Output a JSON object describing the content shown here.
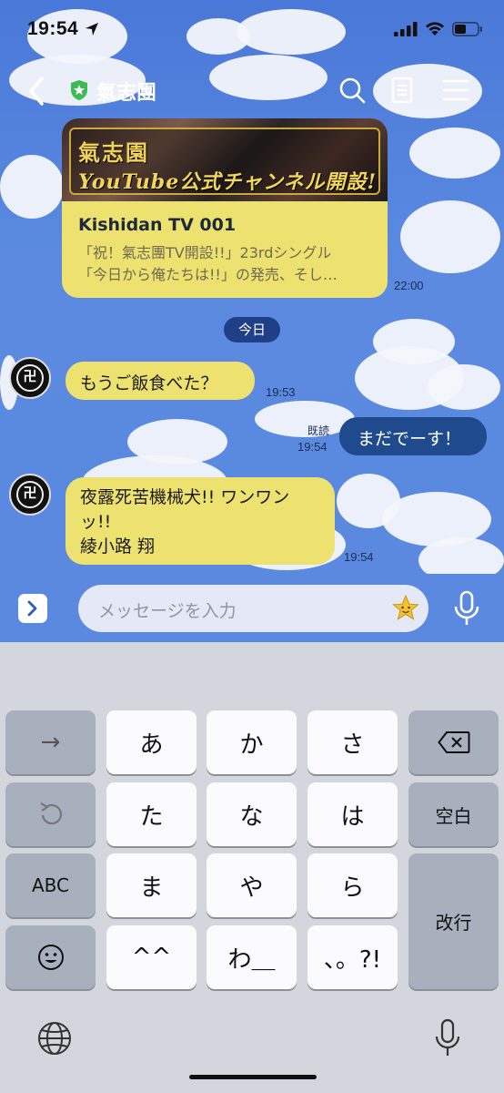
{
  "status_bar": {
    "time": "19:54"
  },
  "header": {
    "title": "氣志團"
  },
  "messages": {
    "card": {
      "image_line1": "氣志園",
      "image_line2": "YouTube公式チャンネル開設!",
      "title": "Kishidan TV 001",
      "desc_line1": "「祝！氣志團TV開設!!」23rdシングル",
      "desc_line2": "「今日から俺たちは!!」の発売、そし…",
      "time": "22:00"
    },
    "date_separator": "今日",
    "msg1": {
      "text": "もうご飯食べた？",
      "time": "19:53"
    },
    "msg2": {
      "text": "まだでーす！",
      "read": "既読",
      "time": "19:54"
    },
    "msg3": {
      "line1": "夜露死苦機械犬!! ワンワン",
      "line2": "ッ!!",
      "line3": "綾小路 翔",
      "time": "19:54"
    }
  },
  "input": {
    "placeholder": "メッセージを入力"
  },
  "keyboard": {
    "keys": {
      "arrow": "→",
      "a": "あ",
      "ka": "か",
      "sa": "さ",
      "ta": "た",
      "na": "な",
      "ha": "は",
      "space": "空白",
      "abc": "ABC",
      "ma": "ま",
      "ya": "や",
      "ra": "ら",
      "enter": "改行",
      "emoticon": "^^",
      "wa": "わ＿",
      "punct": "、。?!"
    }
  },
  "colors": {
    "sky": "#5a89df",
    "bubble_in": "#ede170",
    "bubble_out": "#1f4b8e",
    "date_pill": "#1f3f86"
  }
}
